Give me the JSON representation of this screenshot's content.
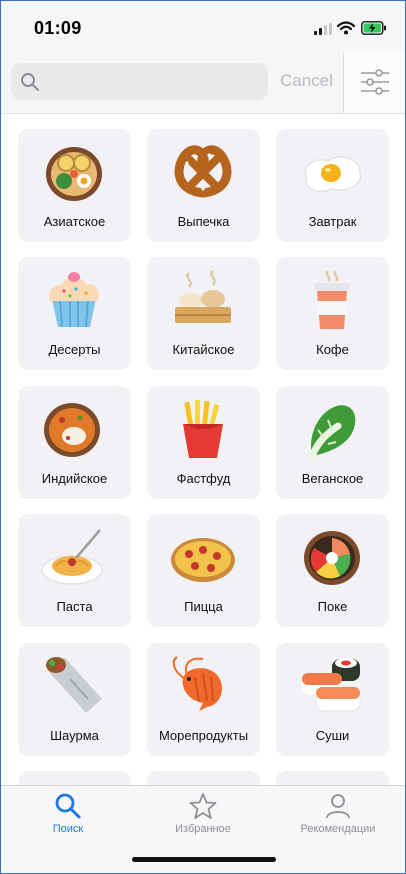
{
  "status": {
    "time": "01:09"
  },
  "search": {
    "placeholder": "",
    "cancel_label": "Cancel",
    "filter_icon": "sliders-icon"
  },
  "categories": [
    {
      "label": "Азиатское",
      "icon": "asian-bowl-icon"
    },
    {
      "label": "Выпечка",
      "icon": "pretzel-icon"
    },
    {
      "label": "Завтрак",
      "icon": "fried-egg-icon"
    },
    {
      "label": "Десерты",
      "icon": "cupcake-icon"
    },
    {
      "label": "Китайское",
      "icon": "dim-sum-icon"
    },
    {
      "label": "Кофе",
      "icon": "coffee-cup-icon"
    },
    {
      "label": "Индийское",
      "icon": "curry-bowl-icon"
    },
    {
      "label": "Фастфуд",
      "icon": "fries-icon"
    },
    {
      "label": "Веганское",
      "icon": "cabbage-icon"
    },
    {
      "label": "Паста",
      "icon": "pasta-plate-icon"
    },
    {
      "label": "Пицца",
      "icon": "pizza-icon"
    },
    {
      "label": "Поке",
      "icon": "poke-bowl-icon"
    },
    {
      "label": "Шаурма",
      "icon": "shawarma-icon"
    },
    {
      "label": "Морепродукты",
      "icon": "shrimp-icon"
    },
    {
      "label": "Суши",
      "icon": "sushi-icon"
    }
  ],
  "tabs": [
    {
      "label": "Поиск",
      "icon": "search-icon",
      "active": true
    },
    {
      "label": "Избранное",
      "icon": "star-icon",
      "active": false
    },
    {
      "label": "Рекомендации",
      "icon": "person-icon",
      "active": false
    }
  ],
  "colors": {
    "accent": "#1f7ae0",
    "tile_bg": "#f2f2f6",
    "battery": "#35c759"
  }
}
